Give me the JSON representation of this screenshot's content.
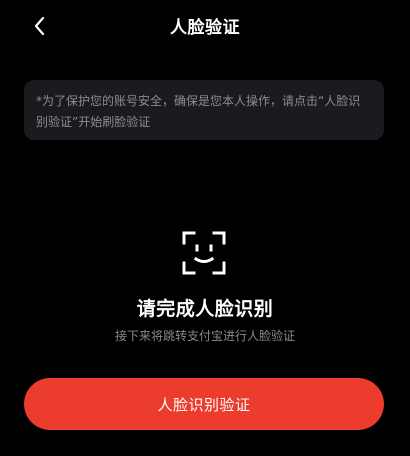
{
  "header": {
    "title": "人脸验证",
    "back_icon": "chevron-left-icon"
  },
  "notice": {
    "text": "*为了保护您的账号安全，确保是您本人操作，请点击“人脸识别验证”开始刷脸验证"
  },
  "main": {
    "icon": "face-scan-icon",
    "title": "请完成人脸识别",
    "subtitle": "接下来将跳转支付宝进行人脸验证"
  },
  "action": {
    "button_label": "人脸识别验证"
  },
  "colors": {
    "background": "#000000",
    "accent": "#ec3c2e",
    "notice_bg": "#1b1b1f",
    "muted_text": "#8c8c8c"
  }
}
